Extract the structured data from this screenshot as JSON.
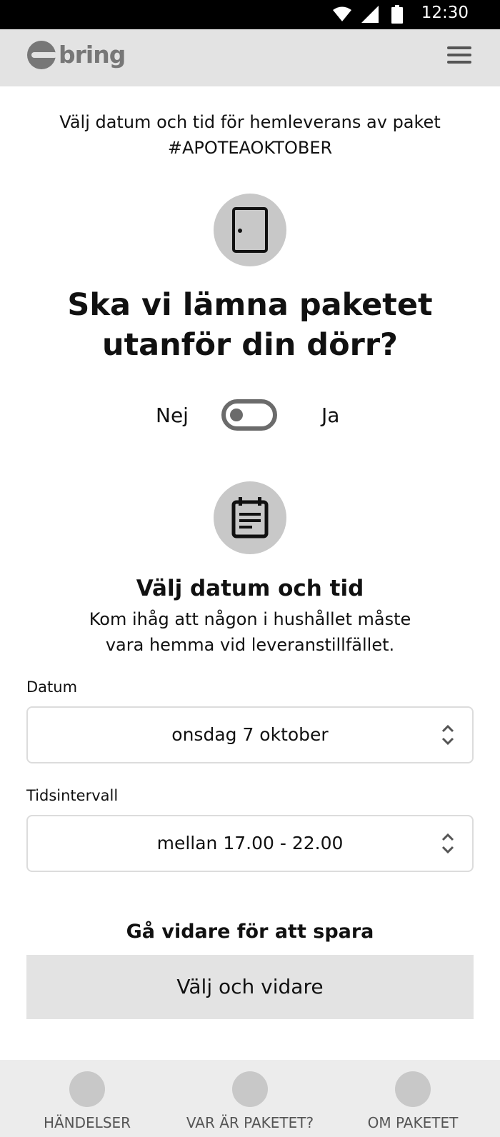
{
  "status_bar": {
    "time": "12:30",
    "icons": [
      "wifi-icon",
      "signal-icon",
      "battery-icon"
    ]
  },
  "header": {
    "logo_text": "bring",
    "menu_icon": "hamburger-menu-icon"
  },
  "intro": {
    "line1": "Välj datum och tid för hemleverans av paket",
    "line2": "#APOTEAOKTOBER"
  },
  "door_section": {
    "icon": "door-icon",
    "question_line1": "Ska vi lämna paketet",
    "question_line2": "utanför din dörr?",
    "toggle": {
      "no_label": "Nej",
      "yes_label": "Ja",
      "checked": false
    }
  },
  "datetime_section": {
    "icon": "calendar-icon",
    "title": "Välj datum och tid",
    "description_line1": "Kom ihåg att någon i hushållet måste",
    "description_line2": "vara hemma vid leveranstillfället.",
    "date_field": {
      "label": "Datum",
      "value": "onsdag 7 oktober"
    },
    "time_field": {
      "label": "Tidsintervall",
      "value": "mellan 17.00 - 22.00"
    }
  },
  "save_section": {
    "title": "Gå vidare för att spara",
    "button_label": "Välj och vidare"
  },
  "bottom_nav": {
    "items": [
      {
        "label": "HÄNDELSER"
      },
      {
        "label": "VAR ÄR PAKETET?"
      },
      {
        "label": "OM PAKETET"
      }
    ]
  },
  "colors": {
    "header_bg": "#e3e3e3",
    "circle_bg": "#c8c8c8",
    "button_bg": "#e3e3e3",
    "nav_bg": "#ececec",
    "toggle": "#6b6b6b"
  }
}
